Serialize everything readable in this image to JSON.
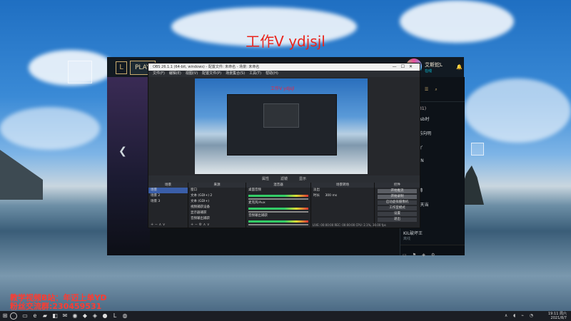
{
  "watermark": "工作V ydjsjl",
  "bottom_text": [
    "教学视频B站：年迈上单YD",
    "粉丝交流群:230459531"
  ],
  "league_client": {
    "play_label": "PLAY",
    "profile_name": "艾斯蛇L",
    "status": "在线",
    "friends_group": "好友 (8/31)",
    "friends": [
      {
        "name": "AD- Garsb时",
        "status": "离线"
      },
      {
        "name": "Angel- 苏向明",
        "status": "离线"
      },
      {
        "name": "Kitten- 丫",
        "status": "离线"
      },
      {
        "name": "FCSG9UN",
        "status": "离线"
      },
      {
        "name": "k5zoe",
        "status": "离线"
      },
      {
        "name": "L老郭苦帅",
        "status": "离线"
      },
      {
        "name": "Rosa+- 天当",
        "status": "离线"
      },
      {
        "name": "Arah宝",
        "status": "离线"
      },
      {
        "name": "KIL破坏王",
        "status": "离线"
      },
      {
        "name": "Lwr- 猴子",
        "status": "离线"
      }
    ]
  },
  "obs": {
    "title": "OBS 26.1.1 (64-bit, windows) - 配置文件: 未命名 - 场景: 未命名",
    "menu": [
      "文件(F)",
      "编辑(E)",
      "视图(V)",
      "配置文件(P)",
      "场景集合(S)",
      "工具(T)",
      "帮助(H)"
    ],
    "preview_caption": "工作V ydjsjl",
    "mode_bar": [
      "属性",
      "滤镜",
      "显示"
    ],
    "dock_scenes": {
      "title": "场景",
      "items": [
        "场景",
        "场景 2",
        "场景 3"
      ]
    },
    "dock_sources": {
      "title": "来源",
      "items": [
        "窗口",
        "文本 (GDI+) 2",
        "文本 (GDI+)",
        "视频捕获设备",
        "显示器捕获",
        "音频输出捕获"
      ]
    },
    "dock_mixer": {
      "title": "混音器",
      "channels": [
        "桌面音频",
        "麦克风/Aux",
        "音频输出捕获"
      ]
    },
    "dock_transitions": {
      "title": "场景转场",
      "type": "淡出",
      "duration_label": "时长",
      "duration": "300 ms"
    },
    "dock_controls": {
      "title": "控件",
      "buttons": [
        "开始推流",
        "开始录制",
        "启动虚拟摄像机",
        "工作室模式",
        "设置",
        "退出"
      ]
    },
    "status_bar": "LIVE: 00:00:00  REC: 00:00:00  CPU: 2.1%, 30.00 fps"
  },
  "taskbar": {
    "time": "19:11 周六",
    "date": "2021/8/7"
  }
}
